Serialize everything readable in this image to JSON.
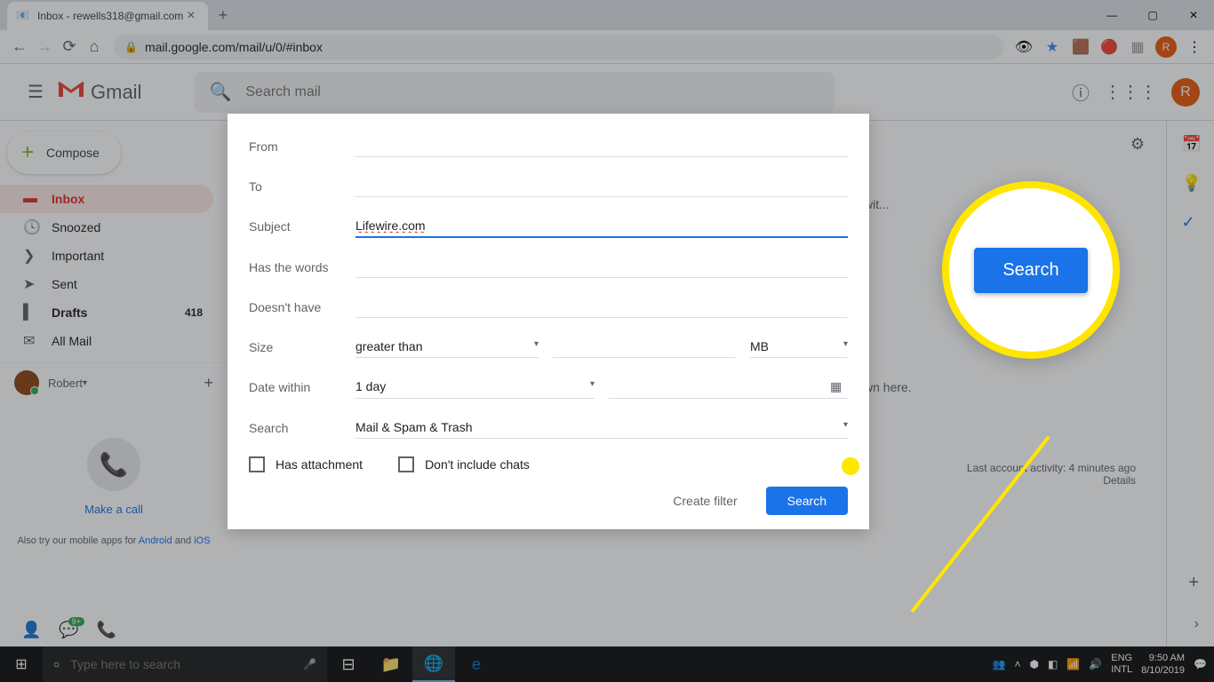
{
  "browser": {
    "tab_title": "Inbox - rewells318@gmail.com",
    "url": "mail.google.com/mail/u/0/#inbox",
    "avatar_letter": "R"
  },
  "gmail": {
    "logo_text": "Gmail",
    "search_placeholder": "Search mail",
    "compose": "Compose",
    "profile_letter": "R"
  },
  "sidebar": {
    "items": [
      {
        "label": "Inbox",
        "icon": "▉"
      },
      {
        "label": "Snoozed",
        "icon": "🕓"
      },
      {
        "label": "Important",
        "icon": "❯"
      },
      {
        "label": "Sent",
        "icon": "➤"
      },
      {
        "label": "Drafts",
        "icon": "▌",
        "count": "418"
      },
      {
        "label": "All Mail",
        "icon": "✉"
      }
    ],
    "user": "Robert",
    "call": "Make a call",
    "mobile_prefix": "Also try our mobile apps for ",
    "mobile_android": "Android",
    "mobile_and": " and ",
    "mobile_ios": "iOS"
  },
  "content": {
    "partial_text": "wn here.",
    "wit_text": "wit...",
    "activity": "Last account activity: 4 minutes ago",
    "details": "Details"
  },
  "search_form": {
    "from": "From",
    "to": "To",
    "subject": "Subject",
    "subject_value": "Lifewire.com",
    "has_words": "Has the words",
    "doesnt_have": "Doesn't have",
    "size": "Size",
    "size_op": "greater than",
    "size_unit": "MB",
    "date_within": "Date within",
    "date_value": "1 day",
    "search_label": "Search",
    "search_scope": "Mail & Spam & Trash",
    "has_attachment": "Has attachment",
    "dont_include": "Don't include chats",
    "create_filter": "Create filter",
    "search_btn": "Search"
  },
  "callout": {
    "btn": "Search"
  },
  "taskbar": {
    "search_placeholder": "Type here to search",
    "lang": "ENG",
    "intl": "INTL",
    "time": "9:50 AM",
    "date": "8/10/2019"
  }
}
